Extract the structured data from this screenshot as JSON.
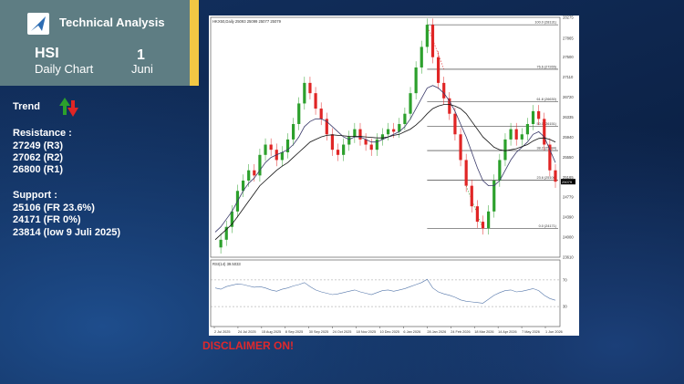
{
  "header": {
    "brand": "Technical Analysis",
    "ticker": "HSI",
    "subtitle": "Daily Chart",
    "day": "1",
    "month": "Juni"
  },
  "info": {
    "trend_label": "Trend",
    "resistance_label": "Resistance :",
    "resistance_levels": [
      "27249 (R3)",
      "27062 (R2)",
      "26800 (R1)"
    ],
    "support_label": "Support :",
    "support_levels": [
      "25106 (FR 23.6%)",
      "24171 (FR 0%)",
      "23814 (low 9 Juli 2025)"
    ]
  },
  "disclaimer": "DISCLAIMER ON!",
  "colors": {
    "up": "#2ca02c",
    "down": "#e02525",
    "header_bg": "#5e7d83",
    "accent": "#f2c744"
  },
  "chart_data": {
    "type": "line",
    "panels": [
      {
        "name": "price",
        "header_text": "HKX50,Daily 25093 25099 25077 25079",
        "y_ticks": [
          28275,
          27865,
          27500,
          27110,
          26720,
          26335,
          25940,
          25550,
          25165,
          24779,
          24390,
          24000,
          23610
        ],
        "x_tick_labels": [
          "2 Jul 2025",
          "24 Jul 2025",
          "15 Aug 2025",
          "8 Sep 2025",
          "30 Sep 2025",
          "24 Oct 2025",
          "18 Nov 2025",
          "10 Dec 2025",
          "6 Jan 2026",
          "28 Jan 2026",
          "24 Feb 2026",
          "18 Mar 2026",
          "14 Apr 2026",
          "7 May 2026",
          "1 Jun 2026"
        ],
        "fib_levels": [
          {
            "label": "100.0 (28131)",
            "value": 28131
          },
          {
            "label": "76.6 (27265)",
            "value": 27265
          },
          {
            "label": "61.8 (26630)",
            "value": 26630
          },
          {
            "label": "50.0 (26151)",
            "value": 26151
          },
          {
            "label": "38.2 (25684)",
            "value": 25684
          },
          {
            "label": "23.6 (25106)",
            "value": 25106
          },
          {
            "label": "0.0 (24171)",
            "value": 24171
          }
        ],
        "current_price_label": "25079",
        "series": [
          {
            "values": [
              23800,
              23950,
              24200,
              24500,
              24900,
              25100,
              25300,
              25200,
              25600,
              25800,
              25700,
              25500,
              25650,
              25900,
              26200,
              26600,
              27000,
              26800,
              26500,
              26300,
              26000,
              25700,
              25600,
              25800,
              25950,
              26100,
              25900,
              25800,
              25700,
              25900,
              26000,
              26100,
              26050,
              26200,
              26400,
              26800,
              27300,
              27700,
              28131,
              27500,
              27000,
              26700,
              26400,
              26000,
              25500,
              25000,
              24600,
              24300,
              24171,
              24500,
              25100,
              25500,
              25900,
              26100,
              25900,
              26000,
              26200,
              26450,
              26300,
              25800,
              25300,
              25079
            ]
          },
          {
            "values": [
              24100,
              24200,
              24350,
              24500,
              24700,
              24900,
              25050,
              25150,
              25300,
              25450,
              25550,
              25600,
              25650,
              25700,
              25800,
              25950,
              26150,
              26250,
              26300,
              26300,
              26250,
              26150,
              26050,
              25950,
              25900,
              25950,
              25950,
              25900,
              25850,
              25850,
              25900,
              25950,
              26000,
              26050,
              26150,
              26300,
              26500,
              26700,
              26900,
              26950,
              26900,
              26800,
              26650,
              26450,
              26200,
              25950,
              25650,
              25350,
              25100,
              25000,
              25000,
              25100,
              25300,
              25500,
              25650,
              25750,
              25850,
              26000,
              26050,
              25950,
              25700,
              25450
            ]
          },
          {
            "values": [
              23950,
              24050,
              24150,
              24250,
              24400,
              24550,
              24700,
              24850,
              25000,
              25100,
              25200,
              25300,
              25380,
              25450,
              25550,
              25650,
              25750,
              25850,
              25900,
              25950,
              25980,
              25990,
              25980,
              25970,
              25960,
              25960,
              25960,
              25950,
              25940,
              25930,
              25930,
              25950,
              25980,
              26000,
              26050,
              26100,
              26180,
              26280,
              26400,
              26500,
              26550,
              26580,
              26580,
              26550,
              26500,
              26400,
              26250,
              26100,
              25950,
              25850,
              25750,
              25700,
              25680,
              25700,
              25720,
              25760,
              25800,
              25870,
              25920,
              25930,
              25900,
              25850
            ]
          }
        ]
      },
      {
        "name": "rsi",
        "header_text": "RSI(14) 39.5033",
        "y_ticks": [
          70,
          30
        ],
        "series": [
          {
            "values": [
              58,
              56,
              60,
              62,
              64,
              63,
              61,
              59,
              60,
              58,
              55,
              53,
              56,
              58,
              61,
              63,
              66,
              60,
              55,
              52,
              50,
              48,
              49,
              51,
              53,
              55,
              52,
              50,
              48,
              51,
              54,
              55,
              53,
              55,
              57,
              60,
              63,
              66,
              71,
              58,
              52,
              49,
              47,
              44,
              40,
              38,
              37,
              36,
              35,
              41,
              47,
              51,
              54,
              55,
              52,
              53,
              55,
              57,
              54,
              47,
              42,
              39.5
            ]
          }
        ]
      }
    ]
  }
}
